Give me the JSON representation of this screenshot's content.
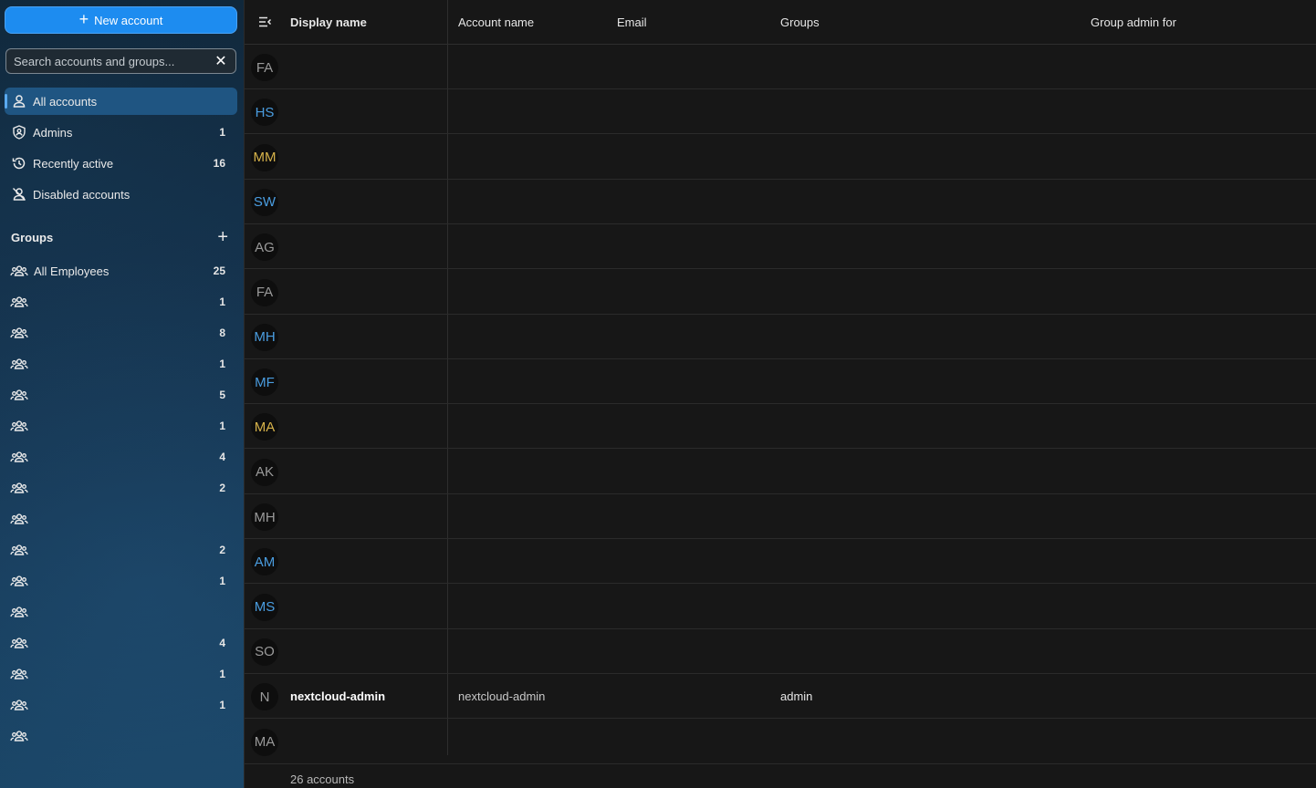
{
  "sidebar": {
    "new_account_label": "New account",
    "search_placeholder": "Search accounts and groups...",
    "nav": [
      {
        "label": "All accounts",
        "count": "",
        "icon": "account-icon",
        "active": true
      },
      {
        "label": "Admins",
        "count": "1",
        "icon": "shield-account-icon",
        "active": false
      },
      {
        "label": "Recently active",
        "count": "16",
        "icon": "history-icon",
        "active": false
      },
      {
        "label": "Disabled accounts",
        "count": "",
        "icon": "account-off-icon",
        "active": false
      }
    ],
    "groups_title": "Groups",
    "groups": [
      {
        "label": "All Employees",
        "count": "25"
      },
      {
        "label": "",
        "count": "1"
      },
      {
        "label": "",
        "count": "8"
      },
      {
        "label": "",
        "count": "1"
      },
      {
        "label": "",
        "count": "5"
      },
      {
        "label": "",
        "count": "1"
      },
      {
        "label": "",
        "count": "4"
      },
      {
        "label": "",
        "count": "2"
      },
      {
        "label": "",
        "count": ""
      },
      {
        "label": "",
        "count": "2"
      },
      {
        "label": "",
        "count": "1"
      },
      {
        "label": "",
        "count": ""
      },
      {
        "label": "",
        "count": "4"
      },
      {
        "label": "",
        "count": "1"
      },
      {
        "label": "",
        "count": "1"
      },
      {
        "label": "",
        "count": ""
      }
    ]
  },
  "table": {
    "headers": {
      "display_name": "Display name",
      "account_name": "Account name",
      "email": "Email",
      "groups": "Groups",
      "group_admin_for": "Group admin for"
    },
    "rows": [
      {
        "initials": "FA",
        "color": "#9a9a9a",
        "display_name": "",
        "account_name": "",
        "groups": ""
      },
      {
        "initials": "HS",
        "color": "#4a9de0",
        "display_name": "",
        "account_name": "",
        "groups": ""
      },
      {
        "initials": "MM",
        "color": "#d6b24a",
        "display_name": "",
        "account_name": "",
        "groups": ""
      },
      {
        "initials": "SW",
        "color": "#4a9de0",
        "display_name": "",
        "account_name": "",
        "groups": ""
      },
      {
        "initials": "AG",
        "color": "#9a9a9a",
        "display_name": "",
        "account_name": "",
        "groups": ""
      },
      {
        "initials": "FA",
        "color": "#9a9a9a",
        "display_name": "",
        "account_name": "",
        "groups": ""
      },
      {
        "initials": "MH",
        "color": "#4a9de0",
        "display_name": "",
        "account_name": "",
        "groups": ""
      },
      {
        "initials": "MF",
        "color": "#4a9de0",
        "display_name": "",
        "account_name": "",
        "groups": ""
      },
      {
        "initials": "MA",
        "color": "#d6b24a",
        "display_name": "",
        "account_name": "",
        "groups": ""
      },
      {
        "initials": "AK",
        "color": "#9a9a9a",
        "display_name": "",
        "account_name": "",
        "groups": ""
      },
      {
        "initials": "MH",
        "color": "#9a9a9a",
        "display_name": "",
        "account_name": "",
        "groups": ""
      },
      {
        "initials": "AM",
        "color": "#4a9de0",
        "display_name": "",
        "account_name": "",
        "groups": ""
      },
      {
        "initials": "MS",
        "color": "#4a9de0",
        "display_name": "",
        "account_name": "",
        "groups": ""
      },
      {
        "initials": "SO",
        "color": "#9a9a9a",
        "display_name": "",
        "account_name": "",
        "groups": ""
      },
      {
        "initials": "N",
        "color": "#9a9a9a",
        "display_name": "nextcloud-admin",
        "account_name": "nextcloud-admin",
        "groups": "admin"
      },
      {
        "initials": "MA",
        "color": "#9a9a9a",
        "display_name": "",
        "account_name": "",
        "groups": ""
      }
    ],
    "footer_count": "26 accounts"
  }
}
